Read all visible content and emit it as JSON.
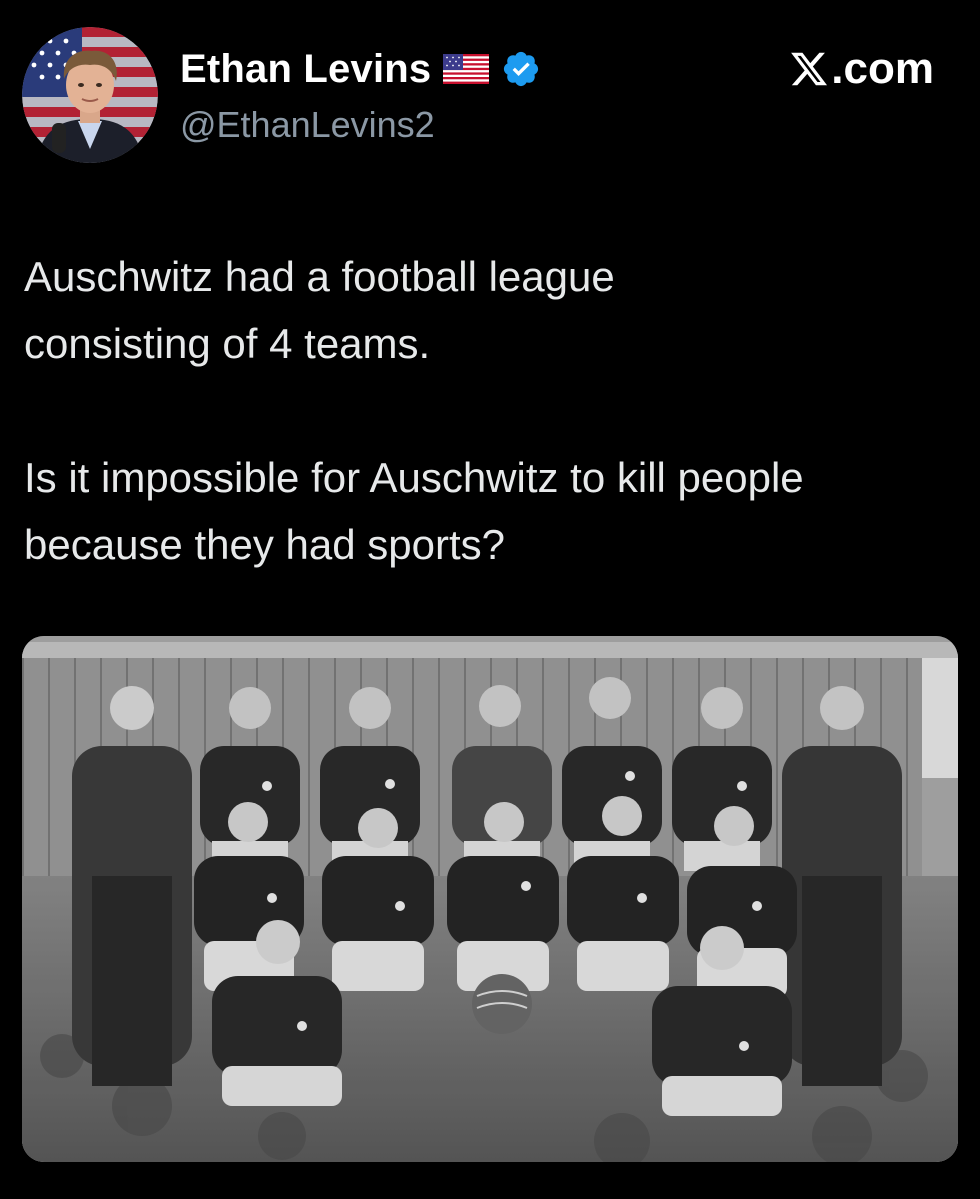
{
  "author": {
    "display_name": "Ethan Levins",
    "handle": "@EthanLevins2",
    "flag_icon": "us-flag-icon",
    "verified_icon": "verified-badge-icon",
    "verified_color": "#1d9bf0",
    "avatar_icon": "profile-photo"
  },
  "source": {
    "site_label": ".com",
    "logo_icon": "x-logo-icon"
  },
  "tweet": {
    "paragraph_1": "Auschwitz had a football league consisting of 4 teams.",
    "paragraph_2": "Is it impossible for Auschwitz to kill people because they had sports?"
  },
  "media": {
    "kind": "black-and-white photograph of football team"
  },
  "colors": {
    "background": "#000000",
    "text_primary": "#e7e9ea",
    "text_secondary": "#8b98a5",
    "accent": "#1d9bf0"
  }
}
